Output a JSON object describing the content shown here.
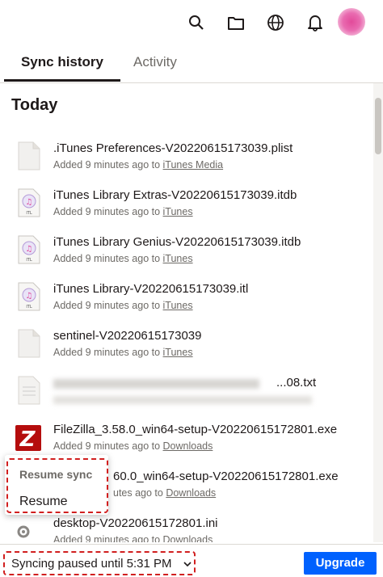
{
  "header": {
    "icons": [
      "search-icon",
      "folder-icon",
      "globe-icon",
      "bell-icon"
    ],
    "avatar_color": "#e24a9a"
  },
  "tabs": [
    {
      "label": "Sync history",
      "active": true
    },
    {
      "label": "Activity",
      "active": false
    }
  ],
  "section": {
    "title": "Today"
  },
  "files": [
    {
      "name": ".iTunes Preferences-V20220615173039.plist",
      "meta": "Added 9 minutes ago to ",
      "folder": "iTunes Media",
      "icon": "blank-file-icon"
    },
    {
      "name": "iTunes Library Extras-V20220615173039.itdb",
      "meta": "Added 9 minutes ago to ",
      "folder": "iTunes",
      "icon": "itunes-file-icon"
    },
    {
      "name": "iTunes Library Genius-V20220615173039.itdb",
      "meta": "Added 9 minutes ago to ",
      "folder": "iTunes",
      "icon": "itunes-file-icon"
    },
    {
      "name": "iTunes Library-V20220615173039.itl",
      "meta": "Added 9 minutes ago to ",
      "folder": "iTunes",
      "icon": "itunes-file-icon"
    },
    {
      "name": "sentinel-V20220615173039",
      "meta": "Added 9 minutes ago to ",
      "folder": "iTunes",
      "icon": "blank-file-icon"
    },
    {
      "name": "...08.txt",
      "meta": "",
      "folder": "",
      "icon": "text-file-icon"
    },
    {
      "name": "FileZilla_3.58.0_win64-setup-V20220615172801.exe",
      "meta": "Added 9 minutes ago to ",
      "folder": "Downloads",
      "icon": "filezilla-icon"
    },
    {
      "name": "60.0_win64-setup-V20220615172801.exe",
      "meta": "utes ago to ",
      "folder": "Downloads",
      "icon": "app-icon"
    },
    {
      "name": "desktop-V20220615172801.ini",
      "meta": "Added 9 minutes ago to ",
      "folder": "Downloads",
      "icon": "settings-file-icon"
    }
  ],
  "popup": {
    "title": "Resume sync",
    "item": "Resume"
  },
  "footer": {
    "status": "Syncing paused until 5:31 PM",
    "upgrade_label": "Upgrade"
  },
  "colors": {
    "accent": "#0061fe",
    "highlight": "#d11f1f",
    "text": "#1e1919",
    "muted": "#6d6a66"
  }
}
